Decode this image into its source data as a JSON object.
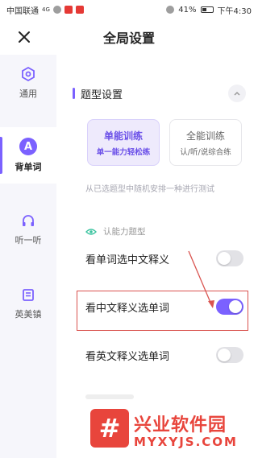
{
  "status_bar": {
    "carrier": "中国联通",
    "network": "4G",
    "battery": "41%",
    "time": "下午4:30"
  },
  "header": {
    "title": "全局设置"
  },
  "sidebar": {
    "items": [
      {
        "label": "通用",
        "icon": "settings-hex-icon",
        "active": false
      },
      {
        "label": "背单词",
        "icon": "letter-a-icon",
        "icon_text": "A",
        "active": true
      },
      {
        "label": "听一听",
        "icon": "headphones-icon",
        "active": false
      },
      {
        "label": "英美镇",
        "icon": "book-icon",
        "active": false
      }
    ]
  },
  "main": {
    "section_title": "题型设置",
    "modes": [
      {
        "title": "单能训练",
        "subtitle": "单一能力轻松练",
        "selected": true
      },
      {
        "title": "全能训练",
        "subtitle": "认/听/说综合练",
        "selected": false
      }
    ],
    "hint": "从已选题型中随机安排一种进行测试",
    "ability_label": "认能力题型",
    "options": [
      {
        "label": "看单词选中文释义",
        "enabled": false
      },
      {
        "label": "看中文释义选单词",
        "enabled": true
      },
      {
        "label": "看英文释义选单词",
        "enabled": false
      }
    ]
  },
  "watermark": {
    "logo_char": "#",
    "title": "兴业软件园",
    "url": "MYXYJS.COM"
  },
  "colors": {
    "accent": "#7b61ff",
    "highlight": "#d9534f",
    "watermark": "#e8453c"
  }
}
